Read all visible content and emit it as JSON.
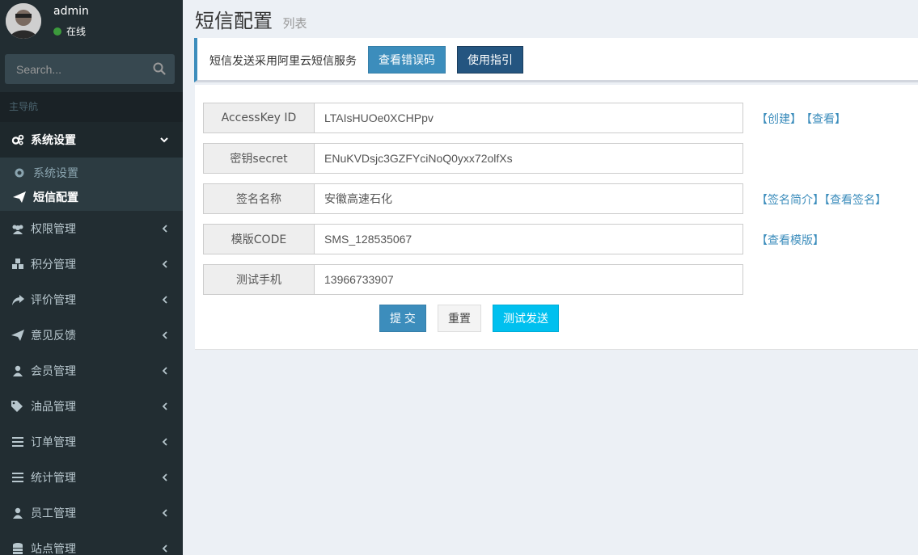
{
  "user": {
    "name": "admin",
    "status": "在线"
  },
  "search": {
    "placeholder": "Search..."
  },
  "sidebar": {
    "header": "主导航",
    "items": [
      {
        "label": "系统设置",
        "icon": "gears-icon"
      },
      {
        "label": "权限管理",
        "icon": "users-icon"
      },
      {
        "label": "积分管理",
        "icon": "cubes-icon"
      },
      {
        "label": "评价管理",
        "icon": "share-icon"
      },
      {
        "label": "意见反馈",
        "icon": "paper-plane-icon"
      },
      {
        "label": "会员管理",
        "icon": "user-icon"
      },
      {
        "label": "油品管理",
        "icon": "tags-icon"
      },
      {
        "label": "订单管理",
        "icon": "bars-icon"
      },
      {
        "label": "统计管理",
        "icon": "bars-icon"
      },
      {
        "label": "员工管理",
        "icon": "user-icon"
      },
      {
        "label": "站点管理",
        "icon": "database-icon"
      }
    ],
    "sub_items": [
      {
        "label": "系统设置",
        "icon": "gear-icon"
      },
      {
        "label": "短信配置",
        "icon": "paper-plane-icon"
      }
    ]
  },
  "page": {
    "title": "短信配置",
    "subtitle": "列表"
  },
  "callout": {
    "text": "短信发送采用阿里云短信服务",
    "errcode_button": "查看错误码",
    "guide_button": "使用指引"
  },
  "form": {
    "access_key": {
      "label": "AccessKey ID",
      "value": "LTAIsHUOe0XCHPpv"
    },
    "secret": {
      "label": "密钥secret",
      "value": "ENuKVDsjc3GZFYciNoQ0yxx72olfXs"
    },
    "sign": {
      "label": "签名名称",
      "value": "安徽高速石化"
    },
    "template": {
      "label": "模版CODE",
      "value": "SMS_128535067"
    },
    "phone": {
      "label": "测试手机",
      "value": "13966733907"
    }
  },
  "links": {
    "create": "【创建】",
    "view": "【查看】",
    "sign_intro": "【签名简介】",
    "view_sign": "【查看签名】",
    "view_template": "【查看模版】"
  },
  "buttons": {
    "submit": "提 交",
    "reset": "重置",
    "test_send": "测试发送"
  },
  "colors": {
    "sidebar_bg": "#222d32",
    "primary": "#3c8dbc",
    "info": "#00c0ef",
    "content_bg": "#ecf0f5"
  }
}
